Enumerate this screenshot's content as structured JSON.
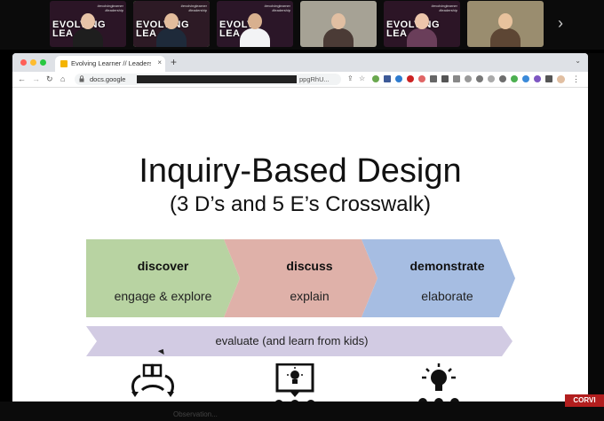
{
  "participants": [
    {
      "name": "participant-1",
      "tile_bg": "#2b1526",
      "skin": "#e7c3a7",
      "clothes": "#1e1e1e",
      "brand": "EVOLVING\nLEA",
      "tag": "#evolvinglearner\n#leadership"
    },
    {
      "name": "participant-2",
      "tile_bg": "#2d1a25",
      "skin": "#e3bc9c",
      "clothes": "#1e2a3a",
      "brand": "EVOLVING\nLEA",
      "tag": "#evolvinglearner\n#leadership",
      "active": true
    },
    {
      "name": "participant-3",
      "tile_bg": "#2b1628",
      "skin": "#d8b08f",
      "clothes": "#f3f3f5",
      "brand": "EVOLV\nLEA",
      "tag": "#evolvinglearner\n#leadership"
    },
    {
      "name": "participant-4",
      "tile_bg": "#a6a295",
      "skin": "#e1bfa2",
      "clothes": "#4b3b36",
      "brand": "",
      "tag": ""
    },
    {
      "name": "participant-5",
      "tile_bg": "#2c1526",
      "skin": "#ecc5ab",
      "clothes": "#6a3e5a",
      "brand": "EVOLVING\nLEA",
      "tag": "#evolvinglearner\n#leadership"
    },
    {
      "name": "participant-6",
      "tile_bg": "#9a8d6f",
      "skin": "#e8c29d",
      "clothes": "#5d4634",
      "brand": "",
      "tag": ""
    }
  ],
  "browser": {
    "tab_title": "Evolving Learner // Leadership",
    "tab_close": "×",
    "new_tab": "+",
    "url_start": "docs.google",
    "url_end": "ppgRhU...",
    "back": "←",
    "forward": "→",
    "reload": "↻",
    "home": "⌂",
    "lock": "🔒",
    "tab_dropdown": "⌄"
  },
  "slide": {
    "title": "Inquiry-Based Design",
    "subtitle": "(3 D’s and 5 E’s Crosswalk)",
    "chevrons": [
      {
        "head": "discover",
        "sub": "engage & explore",
        "color": "#b8d3a2"
      },
      {
        "head": "discuss",
        "sub": "explain",
        "color": "#dfb1a9"
      },
      {
        "head": "demonstrate",
        "sub": "elaborate",
        "color": "#a6bde2"
      }
    ],
    "evaluate": "evaluate (and learn from kids)",
    "evaluate_color": "#d2cbe3"
  },
  "overlay": {
    "bottom_text": "Observation...",
    "corner_badge": "CORVI"
  },
  "next_label": "›"
}
